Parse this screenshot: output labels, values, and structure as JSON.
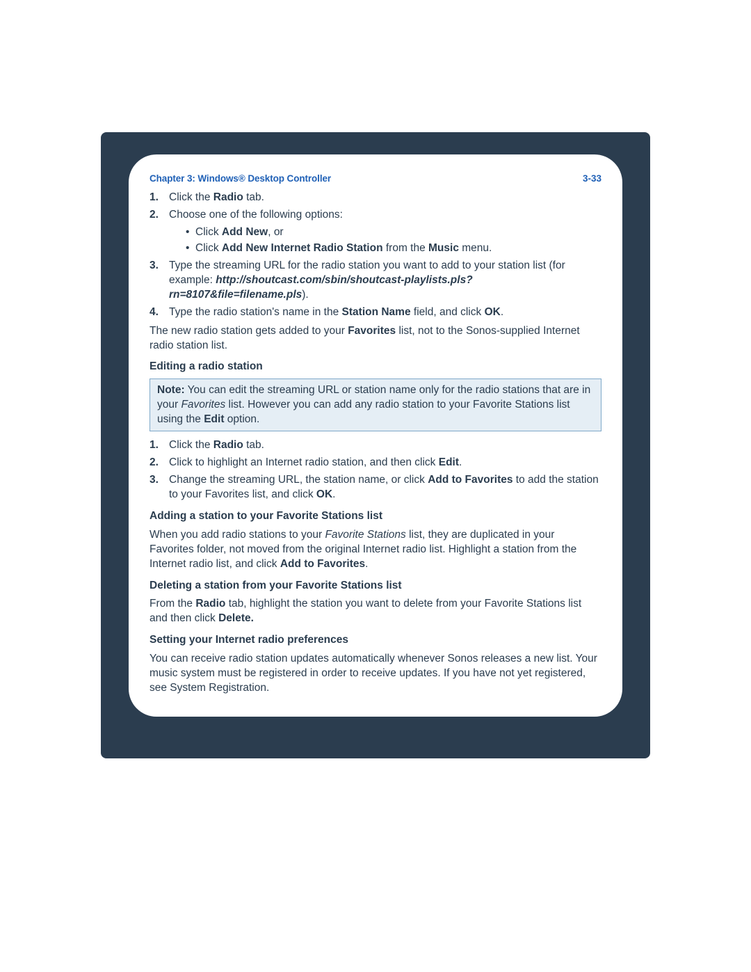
{
  "header": {
    "chapter": "Chapter 3:  Windows® Desktop Controller",
    "page": "3-33"
  },
  "steps_a": {
    "s1": {
      "pre": "Click the ",
      "b1": "Radio",
      "post": " tab."
    },
    "s2": {
      "text": "Choose one of the following options:"
    },
    "s2_sub1": {
      "pre": "Click ",
      "b1": "Add New",
      "post": ", or"
    },
    "s2_sub2": {
      "pre": "Click ",
      "b1": "Add New Internet Radio Station",
      "mid": " from the ",
      "b2": "Music",
      "post": " menu."
    },
    "s3": {
      "pre": "Type the streaming URL for the radio station you want to add to your station list (for example: ",
      "bi": "http://shoutcast.com/sbin/shoutcast-playlists.pls?rn=8107&file=filename.pls",
      "post": ")."
    },
    "s4": {
      "pre": "Type the radio station's name in the ",
      "b1": "Station Name",
      "mid": " field, and click ",
      "b2": "OK",
      "post": "."
    }
  },
  "para_after_a": {
    "pre": "The new radio station gets added to your ",
    "b1": "Favorites",
    "post": " list, not to the Sonos-supplied Internet radio station list."
  },
  "section_editing": "Editing a radio station",
  "note": {
    "label": "Note:",
    "pre": "   You can edit the streaming URL or station name only for the radio stations that are in your ",
    "i1": "Favorites",
    "mid": " list. However you can add any radio station to your Favorite Stations list using the ",
    "b1": "Edit",
    "post": " option."
  },
  "steps_b": {
    "s1": {
      "pre": "Click the ",
      "b1": "Radio",
      "post": " tab."
    },
    "s2": {
      "pre": "Click to highlight an Internet radio station, and then click ",
      "b1": "Edit",
      "post": "."
    },
    "s3": {
      "pre": "Change the streaming URL, the station name, or click ",
      "b1": "Add to Favorites",
      "mid": " to add the station to your Favorites list, and click ",
      "b2": "OK",
      "post": "."
    }
  },
  "section_adding": "Adding a station to your Favorite Stations list",
  "para_adding": {
    "pre": "When you add radio stations to your ",
    "i1": "Favorite Stations",
    "mid": " list, they are duplicated in your Favorites folder, not moved from the original Internet radio list. Highlight a station from the Internet radio list, and click ",
    "b1": "Add to Favorites",
    "post": "."
  },
  "section_deleting": "Deleting a station from your Favorite Stations list",
  "para_deleting": {
    "pre": "From the ",
    "b1": "Radio",
    "mid": " tab, highlight the station you want to delete from your Favorite Stations list and then click ",
    "b2": "Delete.",
    "post": ""
  },
  "section_setting": "Setting your Internet radio preferences",
  "para_setting": {
    "text": "You can receive radio station updates automatically whenever Sonos releases a new list. Your music system must be registered in order to receive updates. If you have not yet registered, see System Registration."
  }
}
